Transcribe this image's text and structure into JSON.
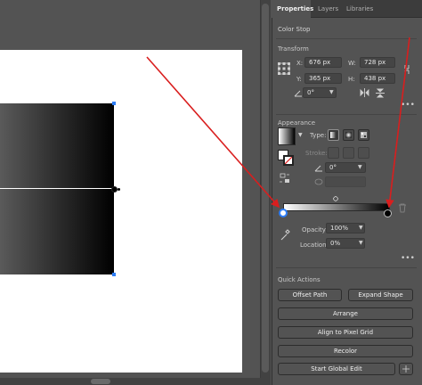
{
  "panel": {
    "tabs": [
      {
        "label": "Properties",
        "active": true
      },
      {
        "label": "Layers",
        "active": false
      },
      {
        "label": "Libraries",
        "active": false
      }
    ],
    "context_title": "Color Stop"
  },
  "transform": {
    "title": "Transform",
    "x_label": "X:",
    "x_value": "676 px",
    "y_label": "Y:",
    "y_value": "365 px",
    "w_label": "W:",
    "w_value": "728 px",
    "h_label": "H:",
    "h_value": "438 px",
    "angle_value": "0°"
  },
  "appearance": {
    "title": "Appearance",
    "type_label": "Type:",
    "stroke_label": "Stroke:",
    "stroke_angle_value": "0°"
  },
  "gradient": {
    "opacity_label": "Opacity:",
    "opacity_value": "100%",
    "location_label": "Location:",
    "location_value": "0%"
  },
  "quick_actions": {
    "title": "Quick Actions",
    "offset_path": "Offset Path",
    "expand_shape": "Expand Shape",
    "arrange": "Arrange",
    "align_pixel_grid": "Align to Pixel Grid",
    "recolor": "Recolor",
    "start_global_edit": "Start Global Edit"
  },
  "colors": {
    "accent_blue": "#2d7df6",
    "annotation_red": "#d91e1e",
    "panel_bg": "#535353",
    "tab_bg": "#3c3c3c"
  }
}
